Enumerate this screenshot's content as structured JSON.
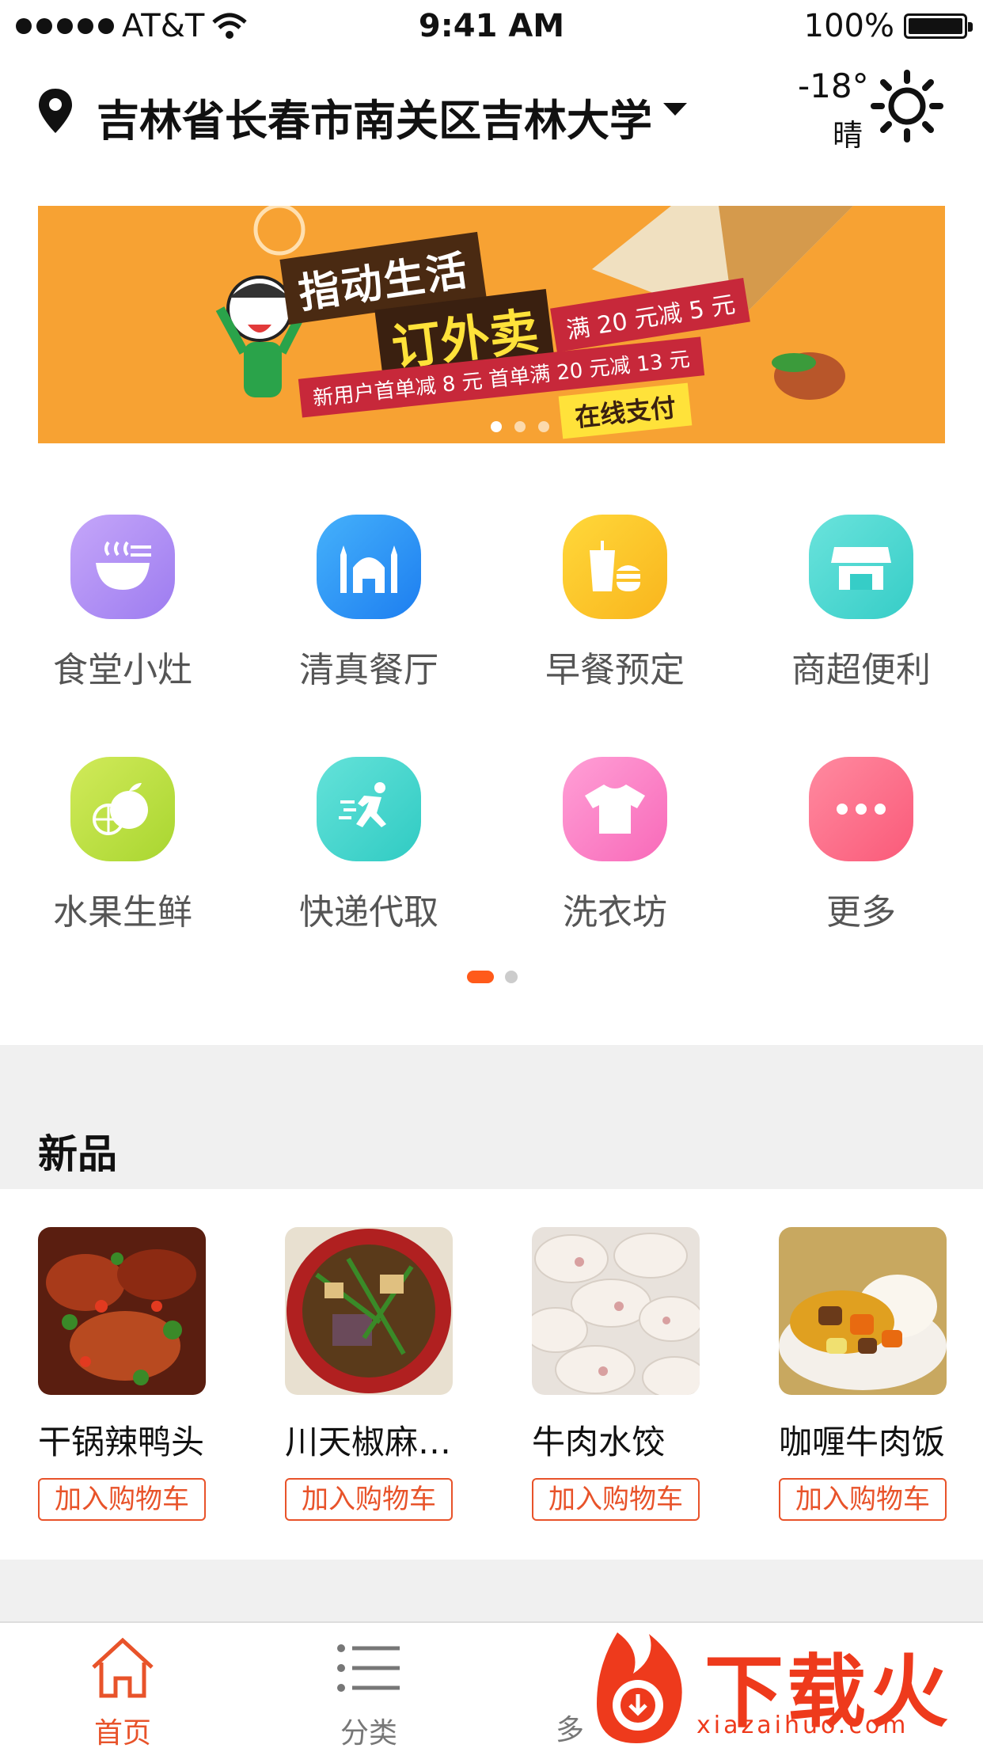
{
  "status_bar": {
    "carrier": "AT&T",
    "time": "9:41 AM",
    "battery": "100%"
  },
  "header": {
    "location": "吉林省长春市南关区吉林大学",
    "temperature": "-18°",
    "weather": "晴"
  },
  "banner": {
    "title": "指动生活",
    "subtitle": "订外卖",
    "promo_full": "满 20 元减 5 元",
    "promo_new": "新用户首单减 8 元  首单满 20 元减 13 元",
    "pay_label": "在线支付",
    "slide_count": 3,
    "active_slide": 1
  },
  "categories": [
    {
      "label": "食堂小灶",
      "icon": "noodle-bowl-icon",
      "color": "#a98bf0"
    },
    {
      "label": "清真餐厅",
      "icon": "mosque-icon",
      "color": "#2f95f4"
    },
    {
      "label": "早餐预定",
      "icon": "breakfast-icon",
      "color": "#fcc72d"
    },
    {
      "label": "商超便利",
      "icon": "store-icon",
      "color": "#4fd8d2"
    },
    {
      "label": "水果生鲜",
      "icon": "fruit-icon",
      "color": "#c2e346"
    },
    {
      "label": "快递代取",
      "icon": "runner-icon",
      "color": "#4cd6cf"
    },
    {
      "label": "洗衣坊",
      "icon": "tshirt-icon",
      "color": "#fb82c8"
    },
    {
      "label": "更多",
      "icon": "more-icon",
      "color": "#fc6f8a"
    }
  ],
  "category_pages": {
    "count": 2,
    "active": 1
  },
  "section": {
    "title": "新品"
  },
  "products": [
    {
      "name": "干锅辣鸭头",
      "button": "加入购物车"
    },
    {
      "name": "川天椒麻…",
      "button": "加入购物车"
    },
    {
      "name": "牛肉水饺",
      "button": "加入购物车"
    },
    {
      "name": "咖喱牛肉饭",
      "button": "加入购物车"
    }
  ],
  "tabs": [
    {
      "label": "首页",
      "icon": "home-icon",
      "active": true
    },
    {
      "label": "分类",
      "icon": "list-icon",
      "active": false
    },
    {
      "label": "多",
      "icon": "cart-icon",
      "active": false
    }
  ],
  "watermark": {
    "text": "下载火",
    "url": "xiazaihuo.com"
  },
  "colors": {
    "accent": "#e8532a",
    "banner_bg": "#f7a233",
    "section_bg": "#f0f0f0"
  }
}
